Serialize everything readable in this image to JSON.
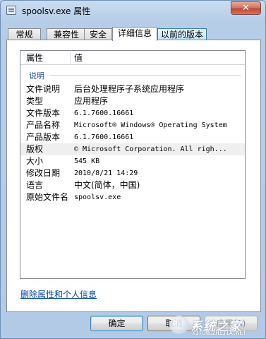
{
  "window": {
    "title": "spoolsv.exe 属性",
    "close_glyph": "✕"
  },
  "tabs": [
    {
      "label": "常规"
    },
    {
      "label": "兼容性"
    },
    {
      "label": "安全"
    },
    {
      "label": "详细信息",
      "active": true
    },
    {
      "label": "以前的版本"
    }
  ],
  "details": {
    "col_property": "属性",
    "col_value": "值",
    "group_label": "说明",
    "rows": [
      {
        "key": "文件说明",
        "value": "后台处理程序子系统应用程序"
      },
      {
        "key": "类型",
        "value": "应用程序"
      },
      {
        "key": "文件版本",
        "value": "6.1.7600.16661"
      },
      {
        "key": "产品名称",
        "value": "Microsoft® Windows® Operating System"
      },
      {
        "key": "产品版本",
        "value": "6.1.7600.16661"
      },
      {
        "key": "版权",
        "value": "© Microsoft Corporation. All righ..."
      },
      {
        "key": "大小",
        "value": "545 KB"
      },
      {
        "key": "修改日期",
        "value": "2010/8/21 14:29"
      },
      {
        "key": "语言",
        "value": "中文(简体，中国)"
      },
      {
        "key": "原始文件名",
        "value": "spoolsv.exe"
      }
    ]
  },
  "link": {
    "label": "删除属性和个人信息"
  },
  "buttons": {
    "ok": "确定",
    "cancel": "取消",
    "apply": "应用(A)"
  },
  "watermark": {
    "text": "系统之家",
    "sub": "XITONGZHIJIA.NET"
  }
}
